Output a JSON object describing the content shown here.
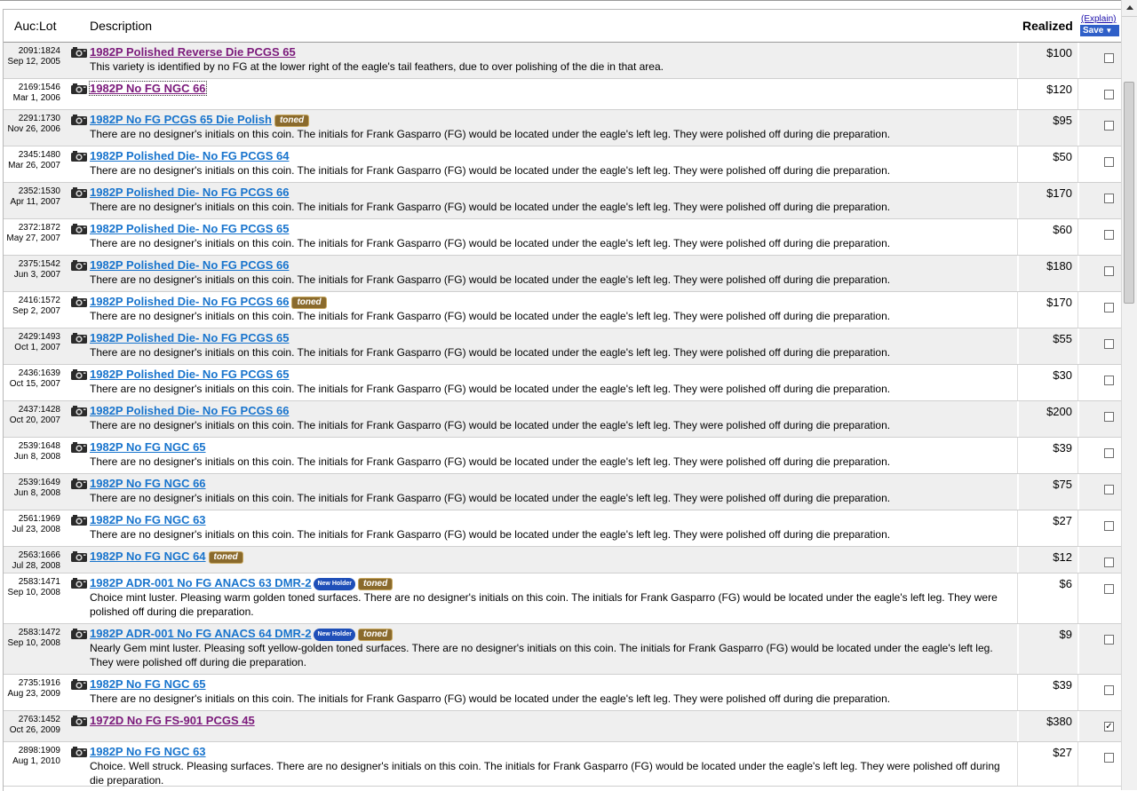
{
  "header": {
    "auclot_label": "Auc:Lot",
    "description_label": "Description",
    "realized_label": "Realized",
    "explain_label": "(Explain)",
    "save_label": "Save"
  },
  "icons": {
    "photo": "camera-icon",
    "save_arrow": "arrow-down-icon",
    "scroll_up": "arrow-up-icon"
  },
  "colors": {
    "link": "#1874cd",
    "visited": "#7b1a7b",
    "row_shade": "#efefef",
    "toned_badge": "#8a6a2c",
    "new_holder_badge": "#1f4fb8"
  },
  "rows": [
    {
      "auclot": "2091:1824",
      "date": "Sep 12, 2005",
      "title": "1982P Polished Reverse Die PCGS 65",
      "badges": [],
      "desc": "This variety is identified by no FG at the lower right of the eagle's tail feathers, due to over polishing of the die in that area.",
      "price": "$100",
      "checked": false,
      "visited": true
    },
    {
      "auclot": "2169:1546",
      "date": "Mar 1, 2006",
      "title": "1982P No FG NGC 66",
      "badges": [],
      "desc": "",
      "price": "$120",
      "checked": false,
      "visited": true,
      "focused": true
    },
    {
      "auclot": "2291:1730",
      "date": "Nov 26, 2006",
      "title": "1982P No FG PCGS 65 Die Polish",
      "badges": [
        "toned"
      ],
      "desc": "There are no designer's initials on this coin. The initials for Frank Gasparro (FG) would be located under the eagle's left leg. They were polished off during die preparation.",
      "price": "$95",
      "checked": false
    },
    {
      "auclot": "2345:1480",
      "date": "Mar 26, 2007",
      "title": "1982P Polished Die- No FG PCGS 64",
      "badges": [],
      "desc": "There are no designer's initials on this coin. The initials for Frank Gasparro (FG) would be located under the eagle's left leg. They were polished off during die preparation.",
      "price": "$50",
      "checked": false
    },
    {
      "auclot": "2352:1530",
      "date": "Apr 11, 2007",
      "title": "1982P Polished Die- No FG PCGS 66",
      "badges": [],
      "desc": "There are no designer's initials on this coin. The initials for Frank Gasparro (FG) would be located under the eagle's left leg. They were polished off during die preparation.",
      "price": "$170",
      "checked": false
    },
    {
      "auclot": "2372:1872",
      "date": "May 27, 2007",
      "title": "1982P Polished Die- No FG PCGS 65",
      "badges": [],
      "desc": "There are no designer's initials on this coin. The initials for Frank Gasparro (FG) would be located under the eagle's left leg. They were polished off during die preparation.",
      "price": "$60",
      "checked": false
    },
    {
      "auclot": "2375:1542",
      "date": "Jun 3, 2007",
      "title": "1982P Polished Die- No FG PCGS 66",
      "badges": [],
      "desc": "There are no designer's initials on this coin. The initials for Frank Gasparro (FG) would be located under the eagle's left leg. They were polished off during die preparation.",
      "price": "$180",
      "checked": false
    },
    {
      "auclot": "2416:1572",
      "date": "Sep 2, 2007",
      "title": "1982P Polished Die- No FG PCGS 66",
      "badges": [
        "toned"
      ],
      "desc": "There are no designer's initials on this coin. The initials for Frank Gasparro (FG) would be located under the eagle's left leg. They were polished off during die preparation.",
      "price": "$170",
      "checked": false
    },
    {
      "auclot": "2429:1493",
      "date": "Oct 1, 2007",
      "title": "1982P Polished Die- No FG PCGS 65",
      "badges": [],
      "desc": "There are no designer's initials on this coin. The initials for Frank Gasparro (FG) would be located under the eagle's left leg. They were polished off during die preparation.",
      "price": "$55",
      "checked": false
    },
    {
      "auclot": "2436:1639",
      "date": "Oct 15, 2007",
      "title": "1982P Polished Die- No FG PCGS 65",
      "badges": [],
      "desc": "There are no designer's initials on this coin. The initials for Frank Gasparro (FG) would be located under the eagle's left leg. They were polished off during die preparation.",
      "price": "$30",
      "checked": false
    },
    {
      "auclot": "2437:1428",
      "date": "Oct 20, 2007",
      "title": "1982P Polished Die- No FG PCGS 66",
      "badges": [],
      "desc": "There are no designer's initials on this coin. The initials for Frank Gasparro (FG) would be located under the eagle's left leg. They were polished off during die preparation.",
      "price": "$200",
      "checked": false
    },
    {
      "auclot": "2539:1648",
      "date": "Jun 8, 2008",
      "title": "1982P No FG NGC 65",
      "badges": [],
      "desc": "There are no designer's initials on this coin. The initials for Frank Gasparro (FG) would be located under the eagle's left leg. They were polished off during die preparation.",
      "price": "$39",
      "checked": false
    },
    {
      "auclot": "2539:1649",
      "date": "Jun 8, 2008",
      "title": "1982P No FG NGC 66",
      "badges": [],
      "desc": "There are no designer's initials on this coin. The initials for Frank Gasparro (FG) would be located under the eagle's left leg. They were polished off during die preparation.",
      "price": "$75",
      "checked": false
    },
    {
      "auclot": "2561:1969",
      "date": "Jul 23, 2008",
      "title": "1982P No FG NGC 63",
      "badges": [],
      "desc": "There are no designer's initials on this coin. The initials for Frank Gasparro (FG) would be located under the eagle's left leg. They were polished off during die preparation.",
      "price": "$27",
      "checked": false
    },
    {
      "auclot": "2563:1666",
      "date": "Jul 28, 2008",
      "title": "1982P No FG NGC 64",
      "badges": [
        "toned"
      ],
      "desc": "",
      "price": "$12",
      "checked": false
    },
    {
      "auclot": "2583:1471",
      "date": "Sep 10, 2008",
      "title": "1982P ADR-001 No FG ANACS 63 DMR-2",
      "badges": [
        "New Holder",
        "toned"
      ],
      "desc": "Choice mint luster. Pleasing warm golden toned surfaces. There are no designer's initials on this coin. The initials for Frank Gasparro (FG) would be located under the eagle's left leg. They were polished off during die preparation.",
      "price": "$6",
      "checked": false
    },
    {
      "auclot": "2583:1472",
      "date": "Sep 10, 2008",
      "title": "1982P ADR-001 No FG ANACS 64 DMR-2",
      "badges": [
        "New Holder",
        "toned"
      ],
      "desc": "Nearly Gem mint luster. Pleasing soft yellow-golden toned surfaces. There are no designer's initials on this coin. The initials for Frank Gasparro (FG) would be located under the eagle's left leg. They were polished off during die preparation.",
      "price": "$9",
      "checked": false
    },
    {
      "auclot": "2735:1916",
      "date": "Aug 23, 2009",
      "title": "1982P No FG NGC 65",
      "badges": [],
      "desc": "There are no designer's initials on this coin. The initials for Frank Gasparro (FG) would be located under the eagle's left leg. They were polished off during die preparation.",
      "price": "$39",
      "checked": false
    },
    {
      "auclot": "2763:1452",
      "date": "Oct 26, 2009",
      "title": "1972D No FG FS-901 PCGS 45",
      "badges": [],
      "desc": "",
      "price": "$380",
      "checked": true,
      "visited": true
    },
    {
      "auclot": "2898:1909",
      "date": "Aug 1, 2010",
      "title": "1982P No FG NGC 63",
      "badges": [],
      "desc": "Choice. Well struck. Pleasing surfaces. There are no designer's initials on this coin. The initials for Frank Gasparro (FG) would be located under the eagle's left leg. They were polished off during die preparation.",
      "price": "$27",
      "checked": false
    }
  ]
}
